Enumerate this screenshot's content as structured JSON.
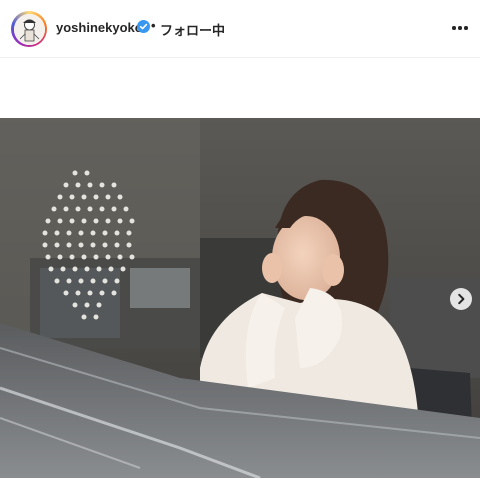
{
  "header": {
    "username": "yoshinekyoko",
    "separator": "•",
    "follow_status": "フォロー中"
  },
  "icons": {
    "avatar": "avatar",
    "verified": "verified-badge-icon",
    "more": "more-options-icon",
    "next": "chevron-right-icon"
  },
  "colors": {
    "verified_blue": "#3897f0",
    "text": "#262626"
  }
}
